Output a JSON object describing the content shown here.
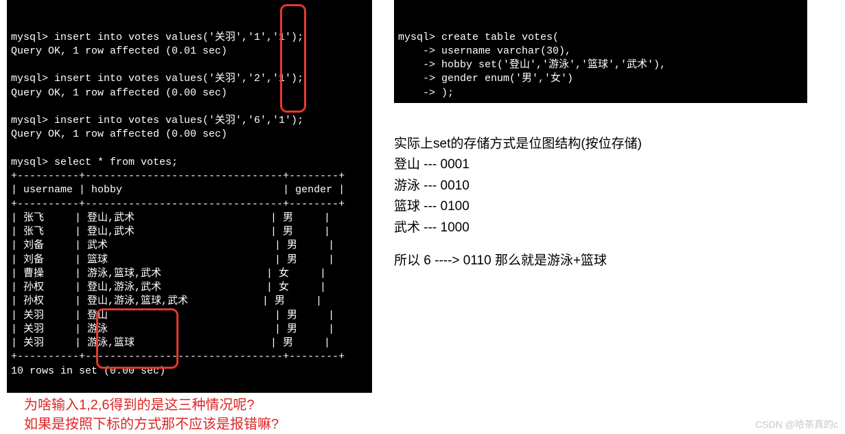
{
  "terminal_left": {
    "lines": [
      "mysql> insert into votes values('关羽','1','1');",
      "Query OK, 1 row affected (0.01 sec)",
      "",
      "mysql> insert into votes values('关羽','2','1');",
      "Query OK, 1 row affected (0.00 sec)",
      "",
      "mysql> insert into votes values('关羽','6','1');",
      "Query OK, 1 row affected (0.00 sec)",
      "",
      "mysql> select * from votes;"
    ],
    "divider": "+----------+--------------------------------+--------+",
    "header": "| username | hobby                          | gender |",
    "rows": [
      {
        "username": "张飞",
        "hobby": "登山,武术",
        "gender": "男"
      },
      {
        "username": "张飞",
        "hobby": "登山,武术",
        "gender": "男"
      },
      {
        "username": "刘备",
        "hobby": "武术",
        "gender": "男"
      },
      {
        "username": "刘备",
        "hobby": "篮球",
        "gender": "男"
      },
      {
        "username": "曹操",
        "hobby": "游泳,篮球,武术",
        "gender": "女"
      },
      {
        "username": "孙权",
        "hobby": "登山,游泳,武术",
        "gender": "女"
      },
      {
        "username": "孙权",
        "hobby": "登山,游泳,篮球,武术",
        "gender": "男"
      },
      {
        "username": "关羽",
        "hobby": "登山",
        "gender": "男"
      },
      {
        "username": "关羽",
        "hobby": "游泳",
        "gender": "男"
      },
      {
        "username": "关羽",
        "hobby": "游泳,篮球",
        "gender": "男"
      }
    ],
    "footer": "10 rows in set (0.00 sec)"
  },
  "terminal_right": {
    "lines": [
      "mysql> create table votes(",
      "    -> username varchar(30),",
      "    -> hobby set('登山','游泳','篮球','武术'),",
      "    -> gender enum('男','女')",
      "    -> );"
    ]
  },
  "explain": {
    "title": "实际上set的存储方式是位图结构(按位存储)",
    "bits": [
      "登山 --- 0001",
      "游泳 --- 0010",
      "篮球 --- 0100",
      "武术 --- 1000"
    ],
    "result": "所以 6 ----> 0110 那么就是游泳+篮球"
  },
  "question": {
    "line1": "为啥输入1,2,6得到的是这三种情况呢?",
    "line2": "如果是按照下标的方式那不应该是报错嘛?"
  },
  "watermark": "CSDN @哈茶真的c"
}
